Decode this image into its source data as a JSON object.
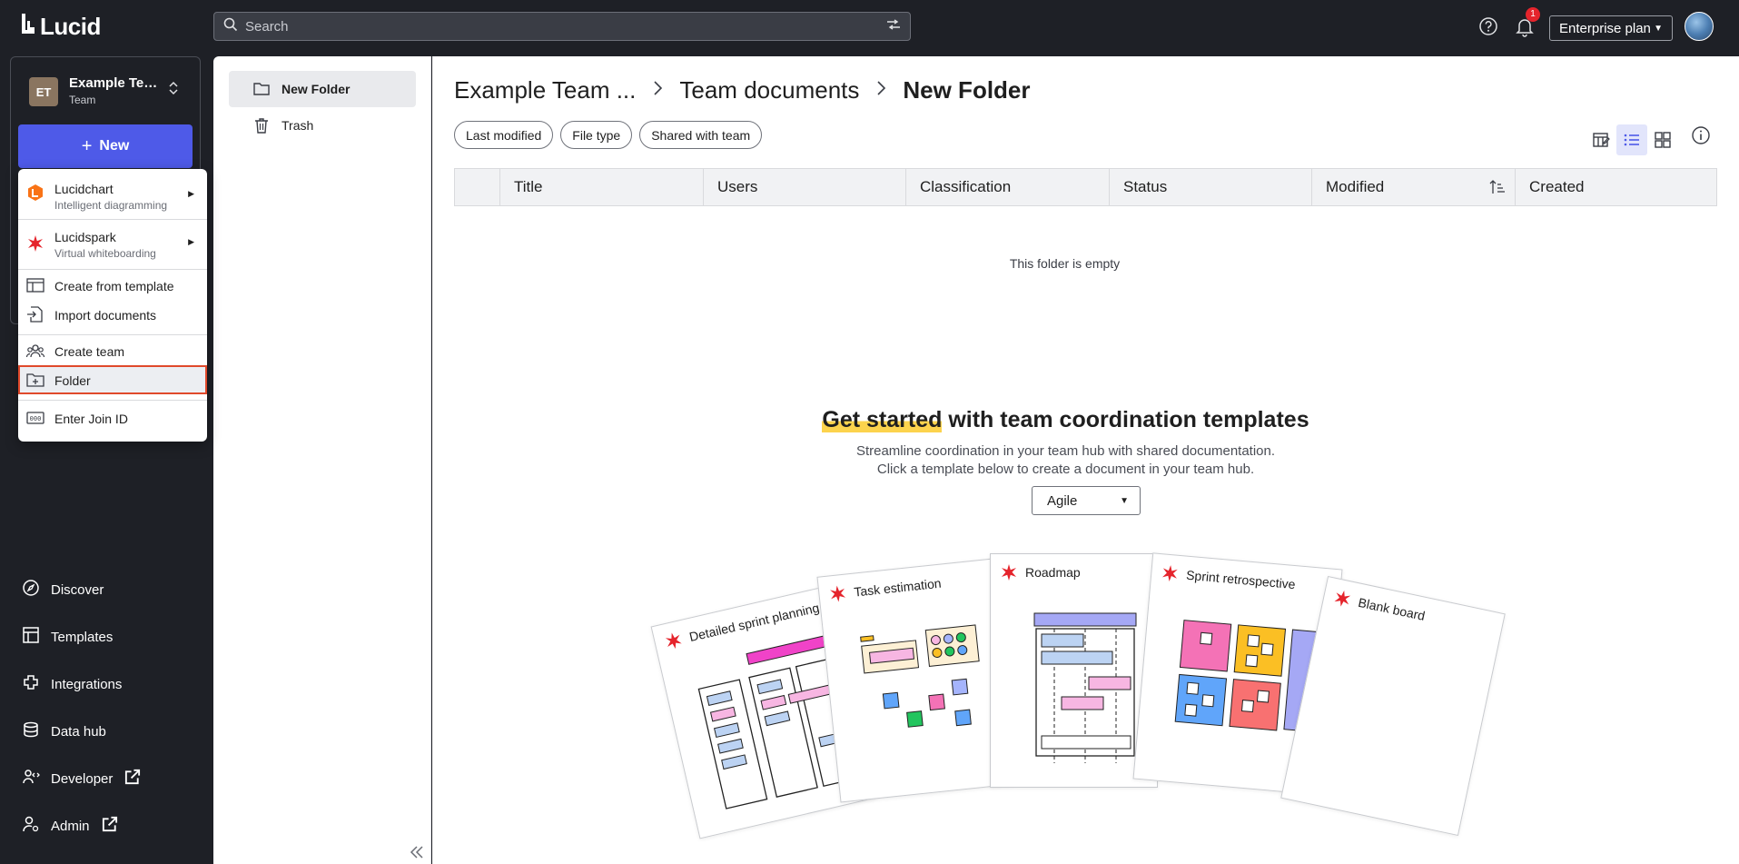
{
  "topbar": {
    "logo_text": "Lucid",
    "search_placeholder": "Search",
    "notification_count": "1",
    "plan_label": "Enterprise plan"
  },
  "team": {
    "initials": "ET",
    "name": "Example Team",
    "type": "Team"
  },
  "new_button": {
    "label": "New"
  },
  "new_menu": {
    "products": [
      {
        "label": "Lucidchart",
        "sub": "Intelligent diagramming"
      },
      {
        "label": "Lucidspark",
        "sub": "Virtual whiteboarding"
      }
    ],
    "create_from_template": "Create from template",
    "import_documents": "Import documents",
    "create_team": "Create team",
    "folder": "Folder",
    "enter_join_id": "Enter Join ID"
  },
  "nav": {
    "discover": "Discover",
    "templates": "Templates",
    "integrations": "Integrations",
    "data_hub": "Data hub",
    "developer": "Developer",
    "admin": "Admin"
  },
  "folders": {
    "new_folder": "New Folder",
    "trash": "Trash"
  },
  "breadcrumb": {
    "root": "Example Team ...",
    "parent": "Team documents",
    "current": "New Folder"
  },
  "filters": [
    "Last modified",
    "File type",
    "Shared with team"
  ],
  "table": {
    "columns": [
      "Title",
      "Users",
      "Classification",
      "Status",
      "Modified",
      "Created"
    ],
    "empty_text": "This folder is empty"
  },
  "get_started": {
    "title_highlight": "Get started",
    "title_rest": " with team coordination templates",
    "line1": "Streamline coordination in your team hub with shared documentation.",
    "line2": "Click a template below to create a document in your team hub.",
    "select_value": "Agile"
  },
  "templates": {
    "sprint_planning": "Detailed sprint planning",
    "task_estimation": "Task estimation",
    "roadmap": "Roadmap",
    "sprint_retro": "Sprint retrospective",
    "blank_board": "Blank board"
  },
  "colors": {
    "accent": "#4e5ae8",
    "dark_bg": "#1e2026",
    "highlight": "#fcd34d",
    "selection_border": "#e0492b",
    "badge": "#e5242c"
  }
}
